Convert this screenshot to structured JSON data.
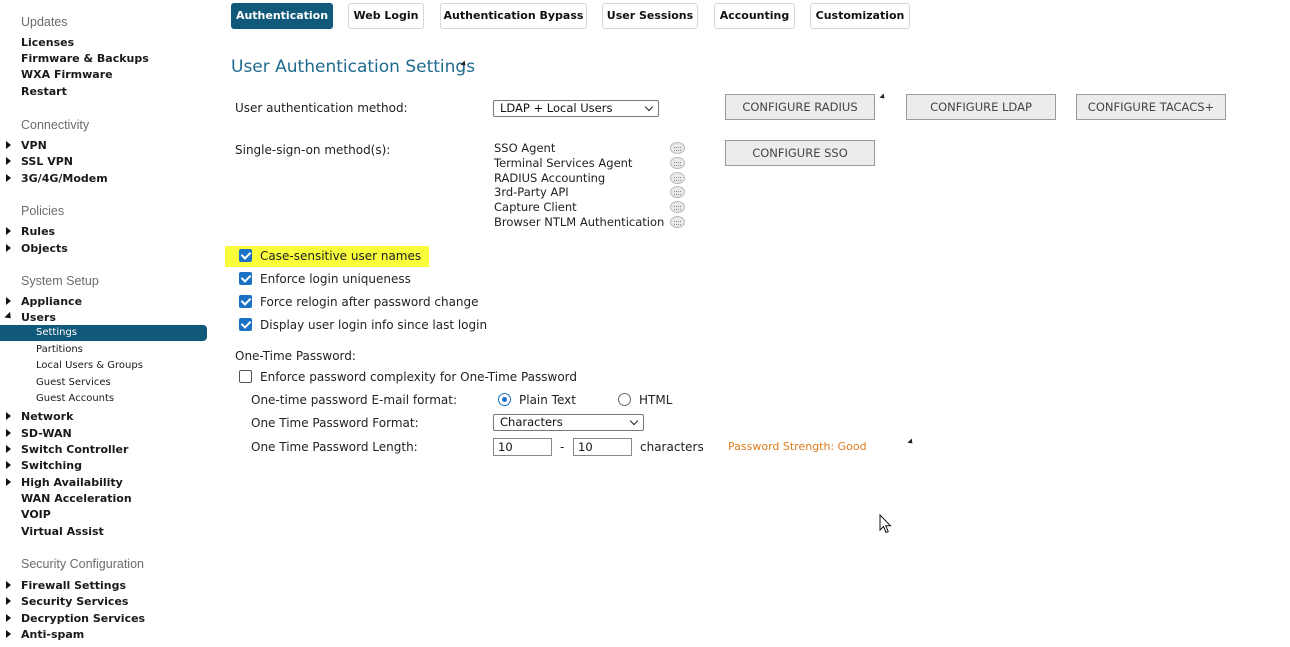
{
  "sidebar": {
    "sections": [
      {
        "title": "Updates",
        "items": [
          {
            "label": "Licenses",
            "caret": "none"
          },
          {
            "label": "Firmware & Backups",
            "caret": "none"
          },
          {
            "label": "WXA Firmware",
            "caret": "none"
          },
          {
            "label": "Restart",
            "caret": "none"
          }
        ]
      },
      {
        "title": "Connectivity",
        "items": [
          {
            "label": "VPN",
            "caret": "right"
          },
          {
            "label": "SSL VPN",
            "caret": "right"
          },
          {
            "label": "3G/4G/Modem",
            "caret": "right"
          }
        ]
      },
      {
        "title": "Policies",
        "items": [
          {
            "label": "Rules",
            "caret": "right"
          },
          {
            "label": "Objects",
            "caret": "right"
          }
        ]
      },
      {
        "title": "System Setup",
        "items": [
          {
            "label": "Appliance",
            "caret": "right"
          },
          {
            "label": "Users",
            "caret": "down",
            "children": [
              {
                "label": "Settings",
                "active": true
              },
              {
                "label": "Partitions"
              },
              {
                "label": "Local Users & Groups"
              },
              {
                "label": "Guest Services"
              },
              {
                "label": "Guest Accounts"
              }
            ]
          },
          {
            "label": "Network",
            "caret": "right"
          },
          {
            "label": "SD-WAN",
            "caret": "right"
          },
          {
            "label": "Switch Controller",
            "caret": "right"
          },
          {
            "label": "Switching",
            "caret": "right"
          },
          {
            "label": "High Availability",
            "caret": "right"
          },
          {
            "label": "WAN Acceleration",
            "caret": "none"
          },
          {
            "label": "VOIP",
            "caret": "none"
          },
          {
            "label": "Virtual Assist",
            "caret": "none"
          }
        ]
      },
      {
        "title": "Security Configuration",
        "items": [
          {
            "label": "Firewall Settings",
            "caret": "right"
          },
          {
            "label": "Security Services",
            "caret": "right"
          },
          {
            "label": "Decryption Services",
            "caret": "right"
          },
          {
            "label": "Anti-spam",
            "caret": "right"
          }
        ]
      }
    ]
  },
  "tabs": [
    {
      "label": "Authentication",
      "active": true
    },
    {
      "label": "Web Login",
      "active": false
    },
    {
      "label": "Authentication Bypass",
      "active": false
    },
    {
      "label": "User Sessions",
      "active": false
    },
    {
      "label": "Accounting",
      "active": false
    },
    {
      "label": "Customization",
      "active": false
    }
  ],
  "main": {
    "title": "User Authentication Settings",
    "auth_method": {
      "label": "User authentication method:",
      "value": "LDAP + Local Users"
    },
    "config_buttons": {
      "radius": "CONFIGURE RADIUS",
      "ldap": "CONFIGURE LDAP",
      "tacacs": "CONFIGURE TACACS+",
      "sso": "CONFIGURE SSO"
    },
    "sso": {
      "label": "Single-sign-on method(s):",
      "methods": [
        "SSO Agent",
        "Terminal Services Agent",
        "RADIUS Accounting",
        "3rd-Party API",
        "Capture Client",
        "Browser NTLM Authentication"
      ]
    },
    "checkboxes": [
      {
        "label": "Case-sensitive user names",
        "checked": true,
        "highlighted": true
      },
      {
        "label": "Enforce login uniqueness",
        "checked": true
      },
      {
        "label": "Force relogin after password change",
        "checked": true
      },
      {
        "label": "Display user login info since last login",
        "checked": true
      }
    ],
    "otp": {
      "heading": "One-Time Password:",
      "complexity": {
        "label": "Enforce password complexity for One-Time Password",
        "checked": false
      },
      "email_format": {
        "label": "One-time password E-mail format:",
        "options": [
          "Plain Text",
          "HTML"
        ],
        "selected": "Plain Text"
      },
      "format": {
        "label": "One Time Password Format:",
        "value": "Characters"
      },
      "length": {
        "label": "One Time Password Length:",
        "min": "10",
        "separator": "-",
        "max": "10",
        "unit": "characters"
      },
      "strength": "Password Strength: Good"
    }
  },
  "colors": {
    "accent": "#11597a",
    "title": "#1f6a8f",
    "check": "#1b72c4",
    "highlight": "#fafd3a",
    "strength": "#e07b1f"
  }
}
